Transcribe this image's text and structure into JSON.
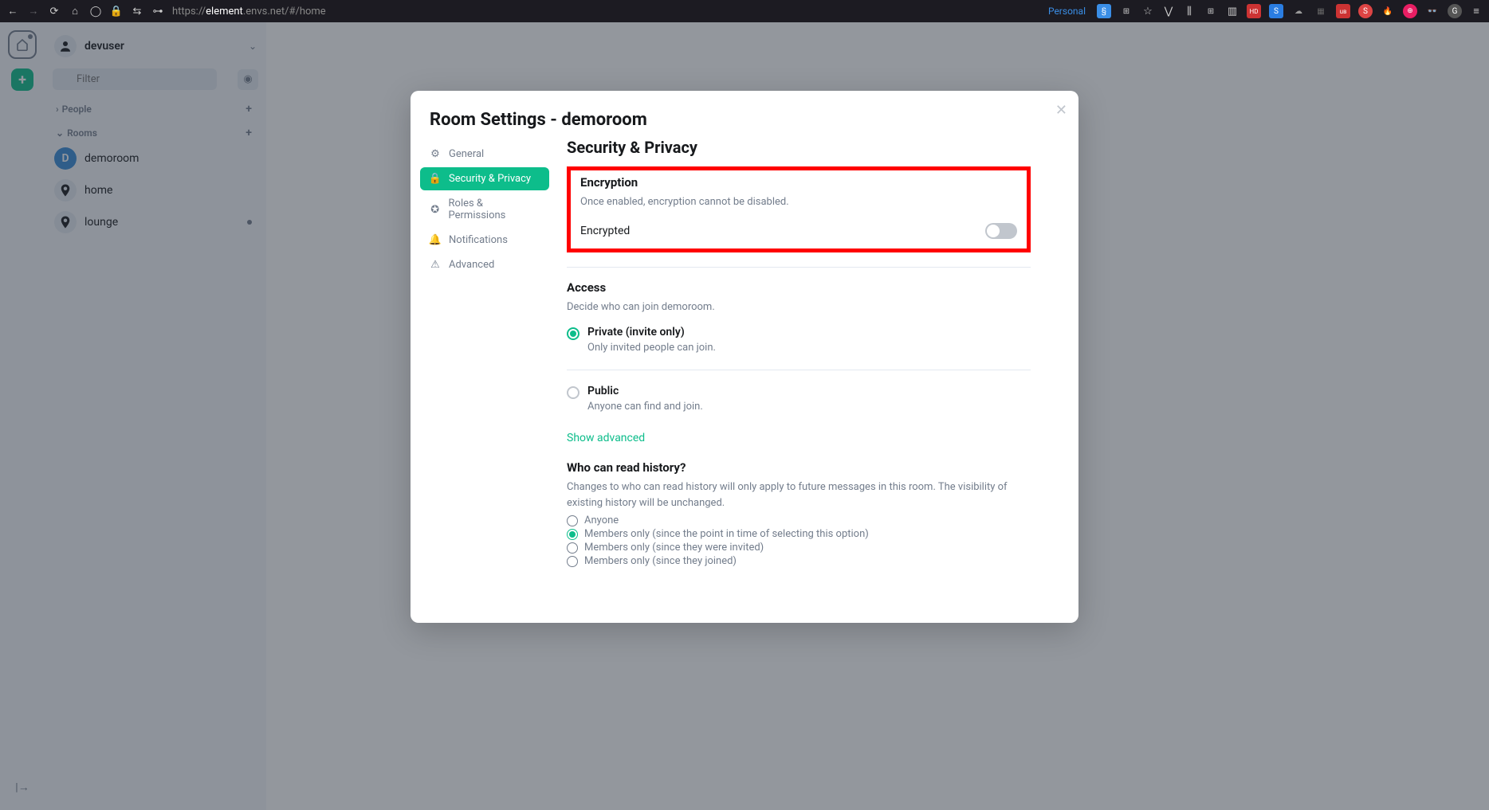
{
  "browser": {
    "url_prefix": "https://",
    "url_domain": "element",
    "url_suffix": ".envs.net/#/home",
    "personal_label": "Personal"
  },
  "sidebar": {
    "username": "devuser",
    "filter_placeholder": "Filter",
    "sections": {
      "people": {
        "label": "People"
      },
      "rooms": {
        "label": "Rooms"
      }
    },
    "rooms": [
      {
        "label": "demoroom",
        "avatar_letter": "D",
        "avatar_type": "letter",
        "has_dot": false
      },
      {
        "label": "home",
        "avatar_type": "pin",
        "has_dot": false
      },
      {
        "label": "lounge",
        "avatar_type": "pin",
        "has_dot": true
      }
    ]
  },
  "dialog": {
    "title": "Room Settings - demoroom",
    "nav": [
      {
        "id": "general",
        "label": "General",
        "active": false
      },
      {
        "id": "security",
        "label": "Security & Privacy",
        "active": true
      },
      {
        "id": "roles",
        "label": "Roles & Permissions",
        "active": false
      },
      {
        "id": "notifications",
        "label": "Notifications",
        "active": false
      },
      {
        "id": "advanced",
        "label": "Advanced",
        "active": false
      }
    ],
    "content": {
      "heading": "Security & Privacy",
      "encryption": {
        "title": "Encryption",
        "desc": "Once enabled, encryption cannot be disabled.",
        "toggle_label": "Encrypted",
        "toggle_on": false
      },
      "access": {
        "title": "Access",
        "desc": "Decide who can join demoroom.",
        "options": [
          {
            "label": "Private (invite only)",
            "desc": "Only invited people can join.",
            "checked": true
          },
          {
            "label": "Public",
            "desc": "Anyone can find and join.",
            "checked": false
          }
        ],
        "show_advanced": "Show advanced"
      },
      "history": {
        "title": "Who can read history?",
        "desc": "Changes to who can read history will only apply to future messages in this room. The visibility of existing history will be unchanged.",
        "options": [
          {
            "label": "Anyone",
            "checked": false
          },
          {
            "label": "Members only (since the point in time of selecting this option)",
            "checked": true
          },
          {
            "label": "Members only (since they were invited)",
            "checked": false
          },
          {
            "label": "Members only (since they joined)",
            "checked": false
          }
        ]
      }
    }
  }
}
